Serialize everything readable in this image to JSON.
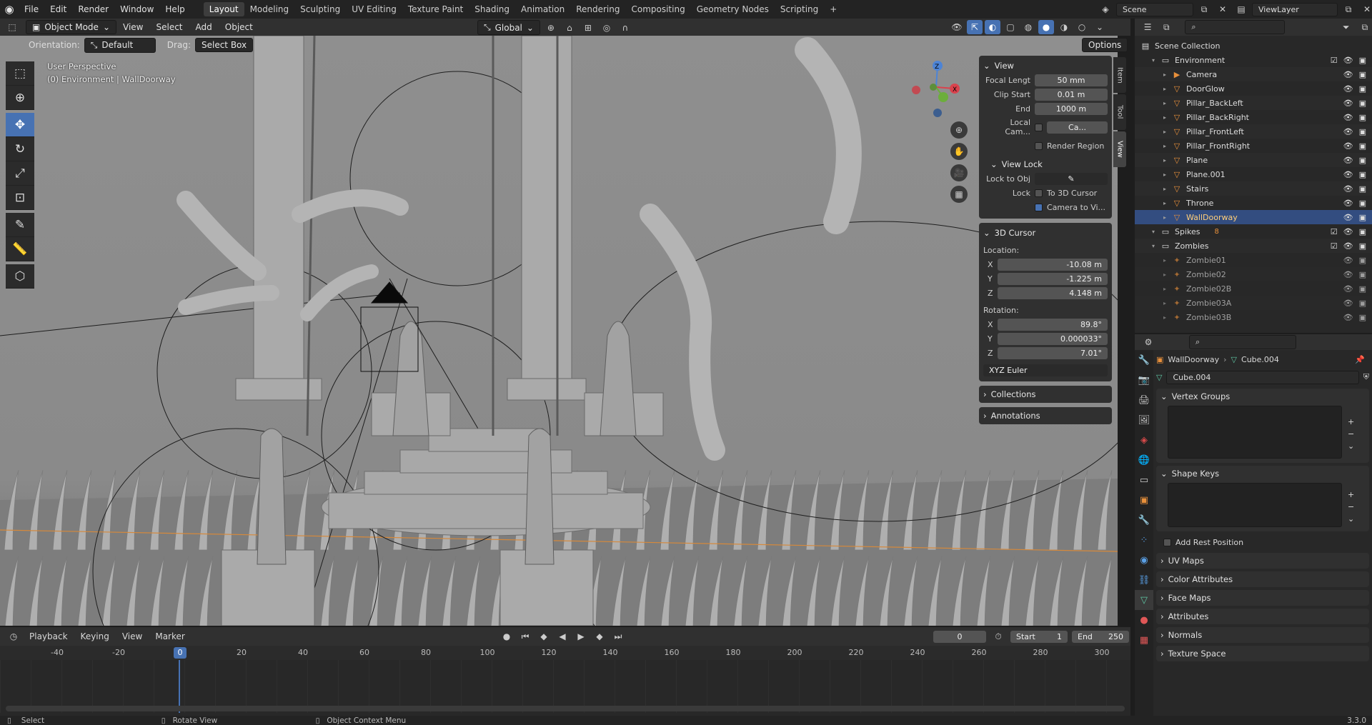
{
  "topbar": {
    "menus": [
      "File",
      "Edit",
      "Render",
      "Window",
      "Help"
    ],
    "workspaces": [
      "Layout",
      "Modeling",
      "Sculpting",
      "UV Editing",
      "Texture Paint",
      "Shading",
      "Animation",
      "Rendering",
      "Compositing",
      "Geometry Nodes",
      "Scripting"
    ],
    "active_workspace": "Layout",
    "add_tab": "+",
    "scene": "Scene",
    "view_layer": "ViewLayer"
  },
  "viewport_header": {
    "mode": "Object Mode",
    "menus": [
      "View",
      "Select",
      "Add",
      "Object"
    ],
    "transform_orientation": "Global",
    "options_label": "Options"
  },
  "tool_settings": {
    "orientation_label": "Orientation:",
    "orientation_value": "Default",
    "drag_label": "Drag:",
    "drag_value": "Select Box"
  },
  "viewport": {
    "perspective": "User Perspective",
    "context": "(0) Environment | WallDoorway"
  },
  "npanel": {
    "tabs": [
      "Item",
      "Tool",
      "View"
    ],
    "active_tab": "View",
    "view_section": {
      "title": "View",
      "focal_length_label": "Focal Lengt",
      "focal_length": "50 mm",
      "clip_start_label": "Clip Start",
      "clip_start": "0.01 m",
      "clip_end_label": "End",
      "clip_end": "1000 m",
      "local_camera_label": "Local Cam...",
      "local_camera_value": "Ca...",
      "render_region_label": "Render Region"
    },
    "view_lock": {
      "title": "View Lock",
      "lock_to_obj_label": "Lock to Obj",
      "lock_label": "Lock",
      "to_3d_cursor": "To 3D Cursor",
      "camera_to_view": "Camera to Vi..."
    },
    "cursor": {
      "title": "3D Cursor",
      "location_label": "Location:",
      "loc_x": "-10.08 m",
      "loc_y": "-1.225 m",
      "loc_z": "4.148 m",
      "rotation_label": "Rotation:",
      "rot_x": "89.8°",
      "rot_y": "0.000033°",
      "rot_z": "7.01°",
      "rotation_mode": "XYZ Euler"
    },
    "collections_label": "Collections",
    "annotations_label": "Annotations"
  },
  "timeline": {
    "menus": [
      "Playback",
      "Keying",
      "View",
      "Marker"
    ],
    "current_frame": "0",
    "start_label": "Start",
    "start": "1",
    "end_label": "End",
    "end": "250",
    "ruler": [
      "-40",
      "-20",
      "0",
      "20",
      "40",
      "60",
      "80",
      "100",
      "120",
      "140",
      "160",
      "180",
      "200",
      "220",
      "240",
      "260",
      "280",
      "300"
    ]
  },
  "status": {
    "select": "Select",
    "rotate": "Rotate View",
    "context_menu": "Object Context Menu",
    "version": "3.3.0"
  },
  "outliner": {
    "root": "Scene Collection",
    "rows": [
      {
        "name": "Environment",
        "type": "collection",
        "level": 1
      },
      {
        "name": "Camera",
        "type": "camera",
        "level": 2
      },
      {
        "name": "DoorGlow",
        "type": "mesh",
        "level": 2
      },
      {
        "name": "Pillar_BackLeft",
        "type": "mesh",
        "level": 2
      },
      {
        "name": "Pillar_BackRight",
        "type": "mesh",
        "level": 2
      },
      {
        "name": "Pillar_FrontLeft",
        "type": "mesh",
        "level": 2
      },
      {
        "name": "Pillar_FrontRight",
        "type": "mesh",
        "level": 2
      },
      {
        "name": "Plane",
        "type": "mesh",
        "level": 2
      },
      {
        "name": "Plane.001",
        "type": "mesh",
        "level": 2
      },
      {
        "name": "Stairs",
        "type": "mesh",
        "level": 2
      },
      {
        "name": "Throne",
        "type": "mesh",
        "level": 2
      },
      {
        "name": "WallDoorway",
        "type": "mesh",
        "level": 2,
        "selected": true
      },
      {
        "name": "Spikes",
        "type": "collection",
        "level": 1,
        "badge": "8"
      },
      {
        "name": "Zombies",
        "type": "collection",
        "level": 1
      },
      {
        "name": "Zombie01",
        "type": "armature",
        "level": 2
      },
      {
        "name": "Zombie02",
        "type": "armature",
        "level": 2
      },
      {
        "name": "Zombie02B",
        "type": "armature",
        "level": 2
      },
      {
        "name": "Zombie03A",
        "type": "armature",
        "level": 2
      },
      {
        "name": "Zombie03B",
        "type": "armature",
        "level": 2
      }
    ]
  },
  "properties": {
    "object_name": "WallDoorway",
    "mesh_name": "Cube.004",
    "data_name": "Cube.004",
    "sections": {
      "vertex_groups": "Vertex Groups",
      "shape_keys": "Shape Keys",
      "add_rest_position": "Add Rest Position",
      "uv_maps": "UV Maps",
      "color_attributes": "Color Attributes",
      "face_maps": "Face Maps",
      "attributes": "Attributes",
      "normals": "Normals",
      "texture_space": "Texture Space"
    }
  },
  "colors": {
    "accent": "#4772b3",
    "selection": "#334d80",
    "viewport_bg": "#8e8e8e",
    "mesh_green": "#5fc7a4",
    "object_orange": "#e8903b"
  }
}
